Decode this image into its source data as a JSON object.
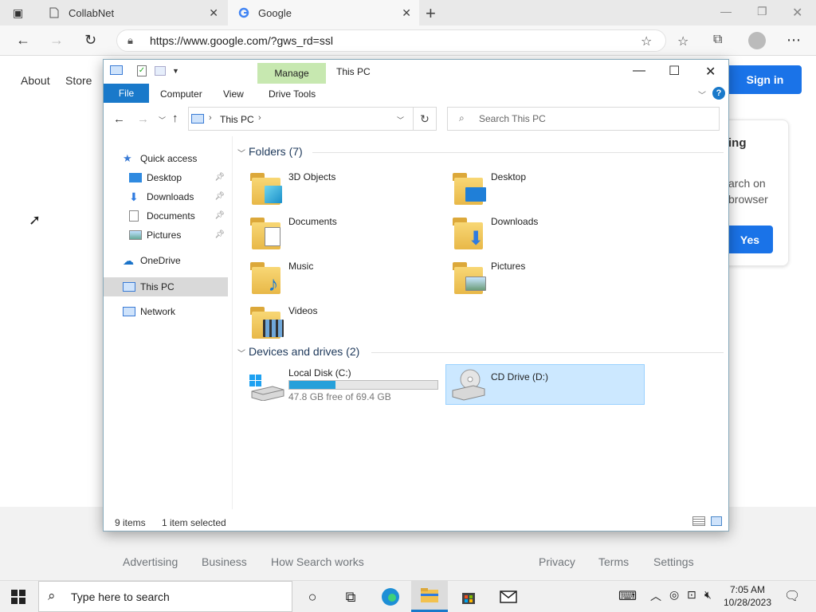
{
  "browser": {
    "tabs": [
      {
        "label": "CollabNet",
        "icon": "page-icon"
      },
      {
        "label": "Google",
        "icon": "google-g-icon",
        "active": true
      }
    ],
    "url": "https://www.google.com/?gws_rd=ssl"
  },
  "google": {
    "nav": [
      "About",
      "Store"
    ],
    "signin": "Sign in",
    "card": {
      "title_fragment": "ing",
      "line1": "arch on",
      "line2": "browser",
      "yes": "Yes"
    },
    "footer_left": [
      "Advertising",
      "Business",
      "How Search works"
    ],
    "footer_right": [
      "Privacy",
      "Terms",
      "Settings"
    ]
  },
  "explorer": {
    "title": "This PC",
    "contextual_tab": "Manage",
    "contextual_group": "Drive Tools",
    "ribbon_tabs": [
      "File",
      "Computer",
      "View"
    ],
    "address": "This PC",
    "search_placeholder": "Search This PC",
    "sidebar": {
      "quick_access": "Quick access",
      "quick_items": [
        "Desktop",
        "Downloads",
        "Documents",
        "Pictures"
      ],
      "onedrive": "OneDrive",
      "thispc": "This PC",
      "network": "Network"
    },
    "folders_header": "Folders (7)",
    "folders": [
      "3D Objects",
      "Desktop",
      "Documents",
      "Downloads",
      "Music",
      "Pictures",
      "Videos"
    ],
    "devices_header": "Devices and drives (2)",
    "drives": [
      {
        "name": "Local Disk (C:)",
        "free": "47.8 GB free of 69.4 GB",
        "used_fraction": 0.31
      },
      {
        "name": "CD Drive (D:)"
      }
    ],
    "status_items": "9 items",
    "status_selected": "1 item selected"
  },
  "taskbar": {
    "search_placeholder": "Type here to search",
    "time": "7:05 AM",
    "date": "10/28/2023"
  },
  "colors": {
    "accent": "#1979ca",
    "google_blue": "#1a73e8",
    "selection": "#cce8ff"
  }
}
